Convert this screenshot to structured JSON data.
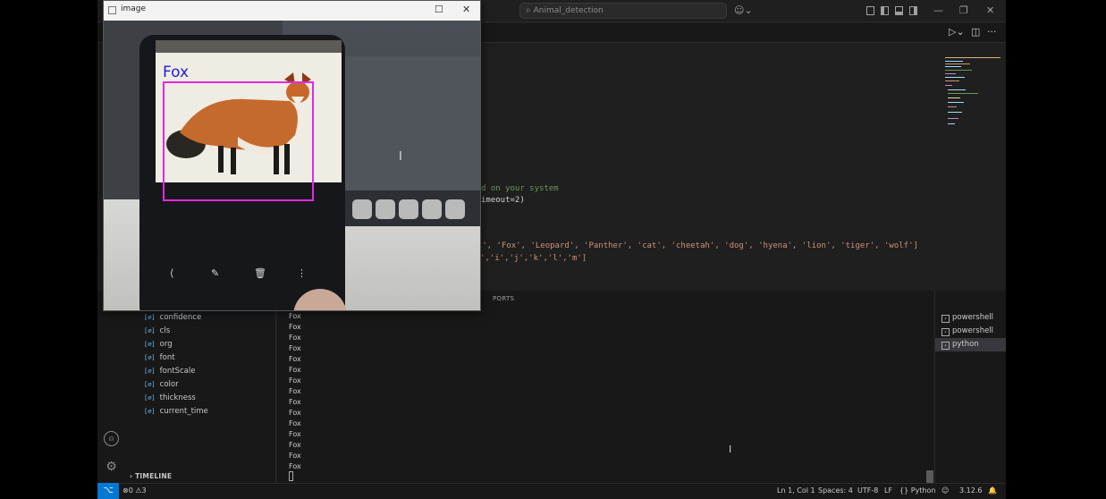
{
  "title_bar": {
    "search_text": "Animal_detection"
  },
  "editor": {
    "line_comment": "d on your system",
    "line_timeout": "imeout=2)",
    "line_classes": "ant', 'Fox', 'Leopard', 'Panther', 'cat', 'cheetah', 'dog', 'hyena', 'lion', 'tiger', 'wolf']",
    "line_keys": "','i','j','k','l','m']"
  },
  "outline": {
    "items": [
      "confidence",
      "cls",
      "org",
      "font",
      "fontScale",
      "color",
      "thickness",
      "current_time"
    ],
    "timeline": "TIMELINE"
  },
  "terminal": {
    "tab_label": "PORTS",
    "output": [
      "Fox",
      "Fox",
      "Fox",
      "Fox",
      "Fox",
      "Fox",
      "Fox",
      "Fox",
      "Fox",
      "Fox",
      "Fox",
      "Fox",
      "Fox",
      "Fox",
      "Fox"
    ],
    "sessions": [
      {
        "name": "powershell",
        "active": false
      },
      {
        "name": "powershell",
        "active": false
      },
      {
        "name": "python",
        "active": true
      }
    ]
  },
  "status_bar": {
    "problems": "0",
    "warnings": "3",
    "position": "Ln 1, Col 1",
    "spaces": "Spaces: 4",
    "encoding": "UTF-8",
    "eol": "LF",
    "language": "Python",
    "python_version": "3.12.6"
  },
  "image_window": {
    "title": "image",
    "detection_label": "Fox",
    "bbox_color": "#e228e2",
    "label_color": "#1f1fd8"
  },
  "colors": {
    "accent": "#0078d4"
  }
}
